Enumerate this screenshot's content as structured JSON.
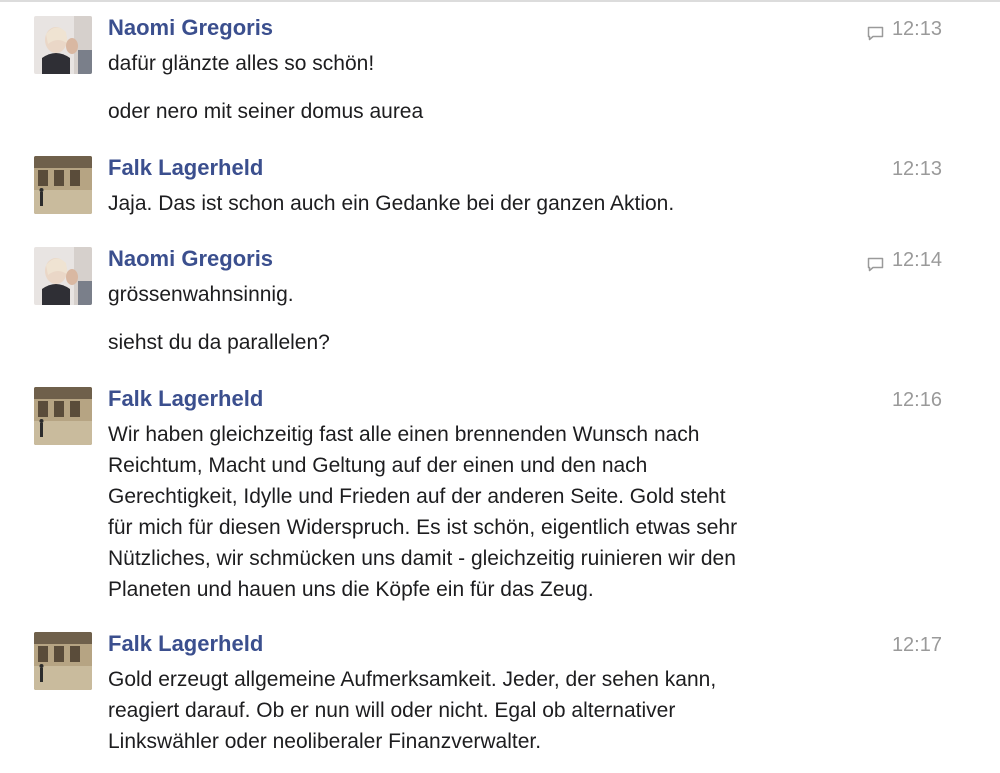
{
  "messages": [
    {
      "author": "Naomi Gregoris",
      "time": "12:13",
      "has_comment_icon": true,
      "avatar_icon": "user-photo-avatar",
      "lines": [
        "dafür glänzte alles so schön!"
      ],
      "followup": "oder nero mit seiner domus aurea"
    },
    {
      "author": "Falk Lagerheld",
      "time": "12:13",
      "has_comment_icon": false,
      "avatar_icon": "building-photo-avatar",
      "lines": [
        "Jaja. Das ist schon auch ein Gedanke bei der ganzen Aktion."
      ]
    },
    {
      "author": "Naomi Gregoris",
      "time": "12:14",
      "has_comment_icon": true,
      "avatar_icon": "user-photo-avatar",
      "lines": [
        "grössenwahnsinnig."
      ],
      "followup": "siehst du da parallelen?"
    },
    {
      "author": "Falk Lagerheld",
      "time": "12:16",
      "has_comment_icon": false,
      "avatar_icon": "building-photo-avatar",
      "lines": [
        "Wir haben gleichzeitig fast alle einen brennenden Wunsch nach",
        "Reichtum, Macht und Geltung auf der einen und den nach",
        "Gerechtigkeit, Idylle und Frieden auf der anderen Seite. Gold steht",
        "für mich für diesen Widerspruch. Es ist schön, eigentlich etwas sehr",
        "Nützliches, wir schmücken uns damit - gleichzeitig ruinieren wir den",
        "Planeten und hauen uns die Köpfe ein für das Zeug."
      ]
    },
    {
      "author": "Falk Lagerheld",
      "time": "12:17",
      "has_comment_icon": false,
      "avatar_icon": "building-photo-avatar",
      "lines": [
        "Gold erzeugt allgemeine Aufmerksamkeit. Jeder, der sehen kann,",
        "reagiert darauf. Ob er nun will oder nicht. Egal ob alternativer",
        "Linkswähler oder neoliberaler Finanzverwalter."
      ]
    }
  ],
  "colors": {
    "author": "#3b4f8e",
    "time": "#9a9a9a",
    "text": "#1d1d1f"
  }
}
